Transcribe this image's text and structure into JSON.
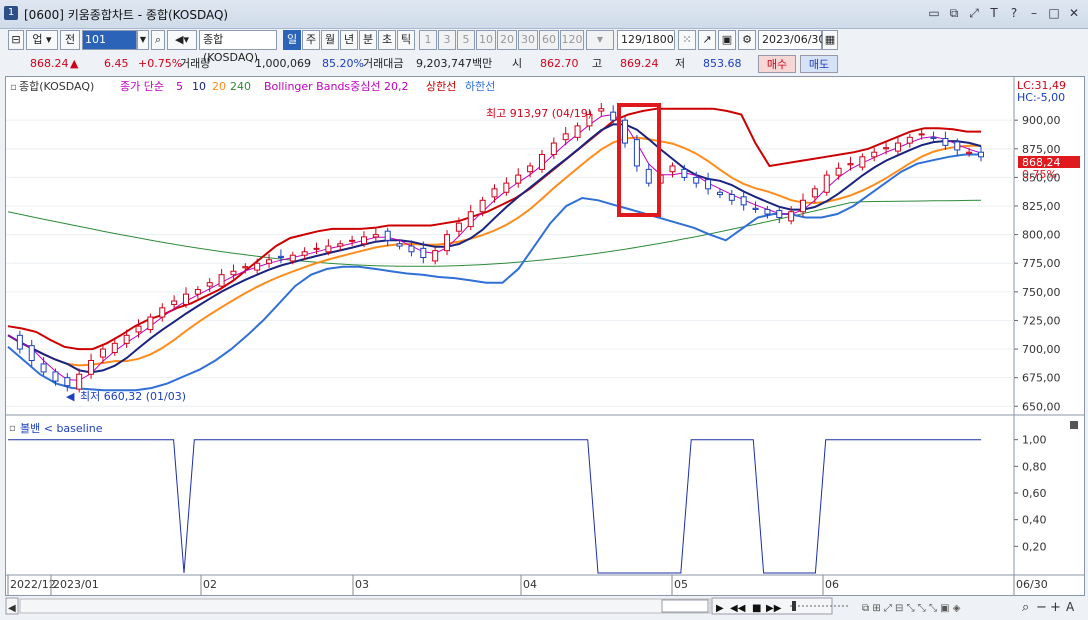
{
  "window": {
    "app_icon": "1",
    "title": "[0600] 키움종합차트 - 종합(KOSDAQ)",
    "buttons": [
      "restore-icon",
      "copy-icon",
      "T",
      "?",
      "minimize-icon",
      "maximize-icon",
      "close-icon"
    ]
  },
  "toolbar": {
    "market": "업",
    "period_label": "전",
    "code": "101",
    "name": "종합(KOSDAQ)",
    "period_tabs": [
      "일",
      "주",
      "월",
      "년",
      "분",
      "초",
      "틱"
    ],
    "active_tab": "일",
    "minute_options": [
      "1",
      "3",
      "5",
      "10",
      "20",
      "30",
      "60",
      "120"
    ],
    "count": "129",
    "count_total": "/1800",
    "date": "2023/06/30"
  },
  "quote": {
    "price": "868.24",
    "change": "6.45",
    "change_pct": "+0.75%",
    "volume_label": "거래량",
    "volume": "1,000,069",
    "volume_pct": "85.20%",
    "amount_label": "거래대금",
    "amount": "9,203,747백만",
    "open_label": "시",
    "open": "862.70",
    "high_label": "고",
    "high": "869.24",
    "low_label": "저",
    "low": "853.68",
    "buy_label": "매수",
    "sell_label": "매도"
  },
  "chart_header": {
    "name": "종합(KOSDAQ)",
    "ma_label": "종가 단순",
    "ma_periods": [
      "5",
      "10",
      "20",
      "240"
    ],
    "bb_label": "Bollinger Bands중심선 20,2",
    "bb_upper": "상한선",
    "bb_lower": "하한선",
    "lc": "LC:31,49",
    "hc": "HC:-5,00"
  },
  "annotations": {
    "high": "최고 913,97 (04/19)",
    "low": "최저 660,32 (01/03)",
    "last_price": "868,24",
    "last_pct": "0,75%"
  },
  "indicator": {
    "label": "볼밴 < baseline"
  },
  "colors": {
    "up": "#d0021b",
    "down": "#1c3fbf",
    "ma5": "#c000c0",
    "ma10": "#1a237e",
    "ma20": "#ff8c1a",
    "ma240": "#2e8b3a",
    "bb_upper": "#cc0000",
    "bb_lower": "#2f6fd6",
    "highlight": "#e0191e"
  },
  "chart_data": [
    {
      "type": "line",
      "title": "종합(KOSDAQ)",
      "x_labels": [
        "2022/12",
        "2023/01",
        "02",
        "03",
        "04",
        "05",
        "06",
        "06/30"
      ],
      "ylim": [
        645,
        922
      ],
      "y_ticks": [
        650,
        675,
        700,
        725,
        750,
        775,
        800,
        825,
        850,
        875,
        900
      ],
      "y_tick_labels": [
        "650,00",
        "675,00",
        "700,00",
        "725,00",
        "750,00",
        "775,00",
        "800,00",
        "825,00",
        "850,00",
        "875,00",
        "900,00"
      ],
      "series": [
        {
          "name": "종가",
          "values": [
            712,
            700,
            690,
            680,
            672,
            668,
            678,
            690,
            700,
            705,
            712,
            720,
            728,
            736,
            742,
            748,
            752,
            758,
            765,
            768,
            772,
            775,
            778,
            780,
            782,
            785,
            788,
            790,
            792,
            795,
            798,
            800,
            795,
            790,
            785,
            780,
            786,
            800,
            810,
            820,
            830,
            840,
            845,
            852,
            860,
            870,
            880,
            888,
            895,
            905,
            910,
            900,
            880,
            860,
            845,
            852,
            860,
            850,
            845,
            840,
            835,
            830,
            826,
            822,
            818,
            815,
            820,
            830,
            840,
            852,
            858,
            862,
            868,
            872,
            876,
            880,
            885,
            888,
            884,
            878,
            874,
            872,
            868
          ]
        },
        {
          "name": "상한선",
          "values": [
            720,
            718,
            715,
            708,
            702,
            700,
            700,
            705,
            712,
            720,
            726,
            730,
            736,
            740,
            746,
            752,
            760,
            770,
            780,
            790,
            797,
            800,
            803,
            805,
            805,
            805,
            806,
            808,
            808,
            808,
            808,
            810,
            812,
            816,
            820,
            826,
            832,
            840,
            850,
            860,
            870,
            880,
            890,
            900,
            905,
            908,
            910,
            910,
            910,
            910,
            910,
            908,
            905,
            880,
            860,
            862,
            864,
            866,
            868,
            870,
            872,
            875,
            880,
            885,
            890,
            893,
            893,
            892,
            890,
            890
          ]
        },
        {
          "name": "하한선",
          "values": [
            702,
            690,
            678,
            670,
            666,
            665,
            664,
            664,
            664,
            666,
            670,
            676,
            682,
            690,
            700,
            712,
            725,
            740,
            755,
            765,
            770,
            772,
            772,
            770,
            768,
            766,
            765,
            763,
            762,
            760,
            758,
            758,
            770,
            790,
            810,
            825,
            832,
            830,
            826,
            822,
            818,
            814,
            810,
            806,
            800,
            795,
            805,
            815,
            818,
            818,
            815,
            815,
            818,
            825,
            835,
            845,
            855,
            862,
            865,
            868,
            870,
            870
          ]
        }
      ]
    },
    {
      "type": "line",
      "title": "볼밴 < baseline",
      "ylim": [
        0,
        1.05
      ],
      "y_ticks": [
        0.2,
        0.4,
        0.6,
        0.8,
        1.0
      ],
      "y_tick_labels": [
        "0,20",
        "0,40",
        "0,60",
        "0,80",
        "1,00"
      ],
      "series": [
        {
          "name": "볼밴 < baseline",
          "values": [
            1,
            1,
            1,
            1,
            1,
            1,
            1,
            1,
            1,
            1,
            1,
            1,
            1,
            1,
            1,
            1,
            1,
            0,
            1,
            1,
            1,
            1,
            1,
            1,
            1,
            1,
            1,
            1,
            1,
            1,
            1,
            1,
            1,
            1,
            1,
            1,
            1,
            1,
            1,
            1,
            1,
            1,
            1,
            1,
            1,
            1,
            1,
            1,
            1,
            1,
            1,
            1,
            1,
            1,
            1,
            1,
            1,
            0,
            0,
            0,
            0,
            0,
            0,
            0,
            0,
            0,
            1,
            1,
            1,
            1,
            1,
            1,
            1,
            0,
            0,
            0,
            0,
            0,
            0,
            1,
            1,
            1,
            1,
            1,
            1,
            1,
            1,
            1,
            1,
            1,
            1,
            1,
            1,
            1,
            1
          ]
        }
      ]
    }
  ],
  "bottombar": {
    "buttons": [
      "▶",
      "◀◀",
      "■",
      "▶▶"
    ]
  }
}
